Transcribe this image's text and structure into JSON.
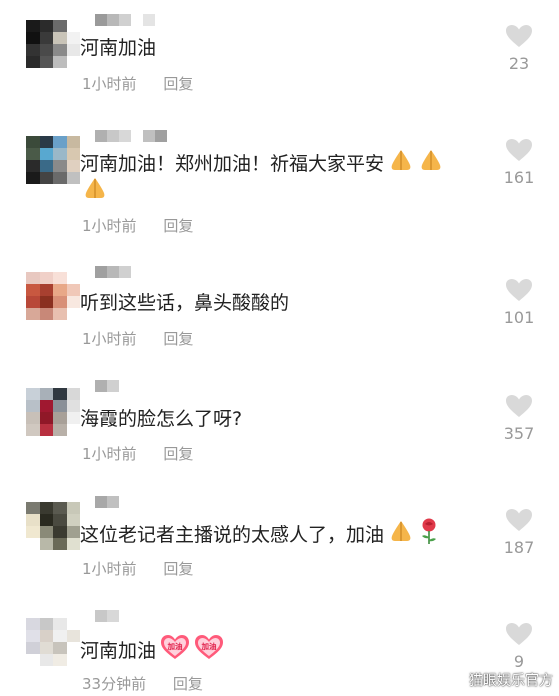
{
  "comments": [
    {
      "text": "河南加油",
      "time": "1小时前",
      "reply": "回复",
      "likes": "23",
      "emojis": [],
      "avatar_colors": [
        "#1a1a1a",
        "#2b2b2b",
        "#6b6b6b",
        "#ffffff",
        "#111111",
        "#3a3a3a",
        "#c9c4b8",
        "#f2f2f2",
        "#333333",
        "#4a4a4a",
        "#8a8a8a",
        "#e8e8e8",
        "#2a2a2a",
        "#555555",
        "#bdbdbd",
        "#ffffff"
      ],
      "name_colors": [
        "#9a9a9a",
        "#b8b8b8",
        "#d0d0d0",
        "#ffffff",
        "#e4e4e4"
      ]
    },
    {
      "text": "河南加油！郑州加油！祈福大家平安",
      "time": "1小时前",
      "reply": "回复",
      "likes": "161",
      "emojis": [
        "pray",
        "pray",
        "pray"
      ],
      "avatar_colors": [
        "#3b4a3a",
        "#2a3a48",
        "#6aa0c8",
        "#c8b9a0",
        "#4a5a48",
        "#58a8d0",
        "#9ab8c8",
        "#d8c8b0",
        "#2a2a2a",
        "#3a6a88",
        "#8a8a8a",
        "#e0d0c0",
        "#1a1a1a",
        "#444444",
        "#6a6a6a",
        "#c0c0c0"
      ],
      "name_colors": [
        "#b0b0b0",
        "#c8c8c8",
        "#d8d8d8",
        "#ffffff",
        "#c0c0c0",
        "#a0a0a0"
      ]
    },
    {
      "text": "听到这些话，鼻头酸酸的",
      "time": "1小时前",
      "reply": "回复",
      "likes": "101",
      "emojis": [],
      "avatar_colors": [
        "#e8c8c0",
        "#f0d0c8",
        "#f8e0d8",
        "#ffffff",
        "#c85840",
        "#a84030",
        "#e8a888",
        "#f0c8b8",
        "#b84838",
        "#8a3020",
        "#d89078",
        "#f8e8e0",
        "#d8a898",
        "#c88878",
        "#e8c0b0",
        "#ffffff"
      ],
      "name_colors": [
        "#a0a0a0",
        "#b8b8b8",
        "#d0d0d0"
      ]
    },
    {
      "text": "海霞的脸怎么了呀?",
      "time": "1小时前",
      "reply": "回复",
      "likes": "357",
      "emojis": [],
      "avatar_colors": [
        "#c8d0d8",
        "#a8b0b8",
        "#303840",
        "#d8d8d8",
        "#b8c0c8",
        "#a01830",
        "#8a9098",
        "#e0e0e0",
        "#c8c0b8",
        "#901828",
        "#a8a098",
        "#f0f0f0",
        "#d0c8c0",
        "#b83040",
        "#b8b0a8",
        "#ffffff"
      ],
      "name_colors": [
        "#b0b0b0",
        "#d0d0d0"
      ]
    },
    {
      "text": "这位老记者主播说的太感人了，加油",
      "time": "1小时前",
      "reply": "回复",
      "likes": "187",
      "emojis": [
        "pray",
        "rose"
      ],
      "avatar_colors": [
        "#7a7a70",
        "#3a3a30",
        "#5a5a50",
        "#c8c8b8",
        "#e8e0c8",
        "#2a2a20",
        "#4a4a40",
        "#d0d0c0",
        "#f0e8d0",
        "#8a8a78",
        "#3a3a30",
        "#a0a090",
        "#ffffff",
        "#b8b8a8",
        "#6a6a58",
        "#e0e0d0"
      ],
      "name_colors": [
        "#a8a8a8",
        "#c0c0c0"
      ]
    },
    {
      "text": "河南加油",
      "time": "33分钟前",
      "reply": "回复",
      "likes": "9",
      "emojis": [
        "jiayou",
        "jiayou"
      ],
      "avatar_colors": [
        "#d8d8e0",
        "#c8c8c8",
        "#e8e8e8",
        "#ffffff",
        "#e0e0e8",
        "#d8d0c8",
        "#f0f0f0",
        "#e8e4dc",
        "#d0d0d8",
        "#e0dcd4",
        "#c8c4bc",
        "#ffffff",
        "#ffffff",
        "#e8e8e8",
        "#f0ece4",
        "#ffffff"
      ],
      "name_colors": [
        "#c8c8c8",
        "#d8d8d8"
      ]
    }
  ],
  "sticker_text": "加油",
  "watermark": "猫眼娱乐官方",
  "colors": {
    "text": "#222222",
    "meta": "#999999",
    "heart": "#d9d9d9"
  }
}
